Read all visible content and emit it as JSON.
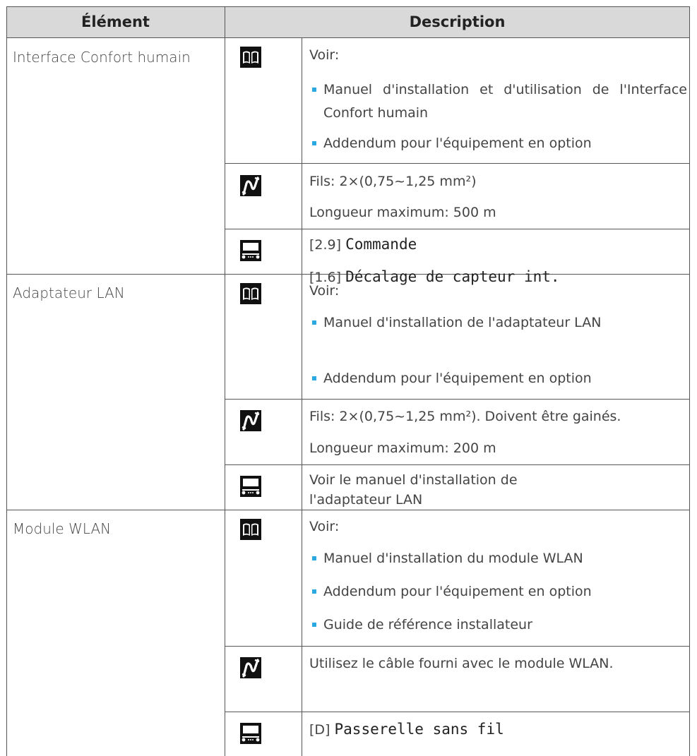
{
  "header": {
    "col_element": "Élément",
    "col_description": "Description"
  },
  "rows": [
    {
      "element": "Interface Confort humain",
      "manual_intro": "Voir:",
      "manual_items": [
        "Manuel d'installation et d'utilisation de l'Interface Confort humain",
        "Addendum pour l'équipement en option"
      ],
      "wire_line1": "Fils: 2×(0,75~1,25 mm²)",
      "wire_line2": "Longueur maximum: 500 m",
      "setting1_code": "[2.9]",
      "setting1_name": "Commande",
      "setting2_code": "[1.6]",
      "setting2_name": "Décalage de capteur int."
    },
    {
      "element": "Adaptateur LAN",
      "manual_intro": "Voir:",
      "manual_items": [
        "Manuel d'installation de l'adaptateur LAN",
        "Addendum pour l'équipement en option"
      ],
      "wire_line1": "Fils: 2×(0,75~1,25 mm²). Doivent être gainés.",
      "wire_line2": "Longueur maximum: 200 m",
      "setting_text_1": "Voir le manuel d'installation de",
      "setting_text_2": "l'adaptateur LAN"
    },
    {
      "element": "Module WLAN",
      "manual_intro": "Voir:",
      "manual_items": [
        "Manuel d'installation du module WLAN",
        "Addendum pour l'équipement en option",
        "Guide de référence installateur"
      ],
      "wire_line1": "Utilisez le câble fourni avec le module WLAN.",
      "setting1_code": "[D]",
      "setting1_name": "Passerelle sans fil"
    }
  ],
  "icons": {
    "manual": "book-icon",
    "wiring": "cable-icon",
    "settings": "remote-controller-icon"
  },
  "colors": {
    "bullet": "#2aa9e0",
    "header_bg": "#d9d9d9",
    "icon_bg": "#111111"
  }
}
